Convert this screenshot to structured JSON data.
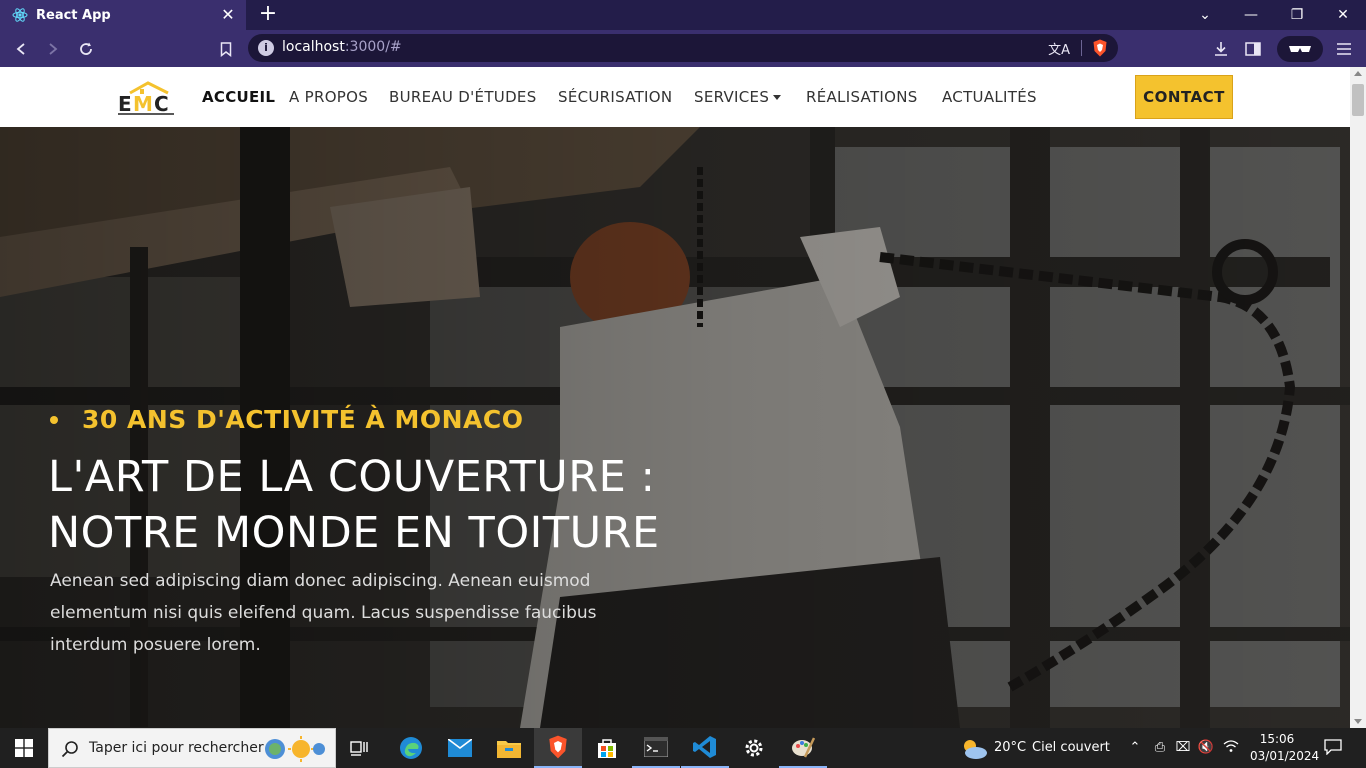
{
  "browser": {
    "tab_title": "React App",
    "url_host": "localhost",
    "url_path": ":3000/#"
  },
  "nav": {
    "items": [
      {
        "label": "ACCUEIL"
      },
      {
        "label": "A PROPOS"
      },
      {
        "label": "BUREAU D'ÉTUDES"
      },
      {
        "label": "SÉCURISATION"
      },
      {
        "label": "SERVICES"
      },
      {
        "label": "RÉALISATIONS"
      },
      {
        "label": "ACTUALITÉS"
      }
    ],
    "contact_label": "CONTACT"
  },
  "hero": {
    "eyebrow": "30 ANS D'ACTIVITÉ À MONACO",
    "title_line1": "L'ART DE LA COUVERTURE :",
    "title_line2": "NOTRE MONDE EN TOITURE",
    "text_line1": "Aenean sed adipiscing diam donec adipiscing. Aenean euismod",
    "text_line2": "elementum nisi quis eleifend quam. Lacus suspendisse faucibus",
    "text_line3": "interdum posuere lorem."
  },
  "taskbar": {
    "search_placeholder": "Taper ici pour rechercher",
    "weather_temp": "20°C",
    "weather_text": "Ciel couvert",
    "time": "15:06",
    "date": "03/01/2024"
  },
  "colors": {
    "accent": "#f4c22e",
    "browser_bg": "#3a2f6e"
  }
}
